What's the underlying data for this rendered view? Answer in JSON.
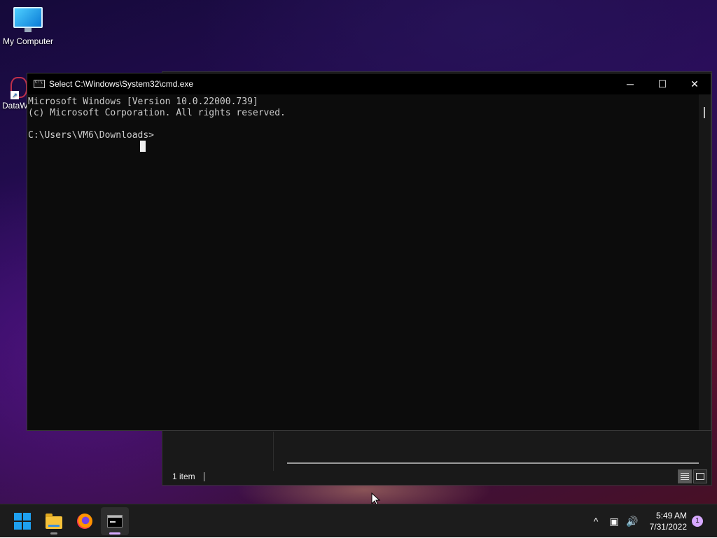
{
  "desktop": {
    "icons": [
      {
        "label": "My Computer",
        "icon": "monitor-icon"
      },
      {
        "label": "DataW",
        "icon": "shortcut-icon"
      }
    ]
  },
  "explorer": {
    "status_text": "1 item",
    "views": [
      "details-view-icon",
      "large-icons-view-icon"
    ]
  },
  "cmd_window": {
    "title": "Select C:\\Windows\\System32\\cmd.exe",
    "controls": {
      "minimize": "─",
      "maximize": "☐",
      "close": "✕"
    },
    "lines": [
      "Microsoft Windows [Version 10.0.22000.739]",
      "(c) Microsoft Corporation. All rights reserved.",
      "",
      "C:\\Users\\VM6\\Downloads>"
    ],
    "colors": {
      "background": "#0c0c0c",
      "text": "#cccccc",
      "titlebar": "#000000"
    }
  },
  "taskbar": {
    "items": [
      {
        "name": "start",
        "icon": "windows-logo-icon"
      },
      {
        "name": "file-explorer",
        "icon": "folder-icon"
      },
      {
        "name": "firefox",
        "icon": "firefox-icon"
      },
      {
        "name": "command-prompt",
        "icon": "cmd-icon"
      }
    ],
    "tray": {
      "chevron": "^",
      "network": "▣",
      "volume": "🔊"
    },
    "clock": {
      "time": "5:49 AM",
      "date": "7/31/2022"
    },
    "notifications": "1"
  }
}
